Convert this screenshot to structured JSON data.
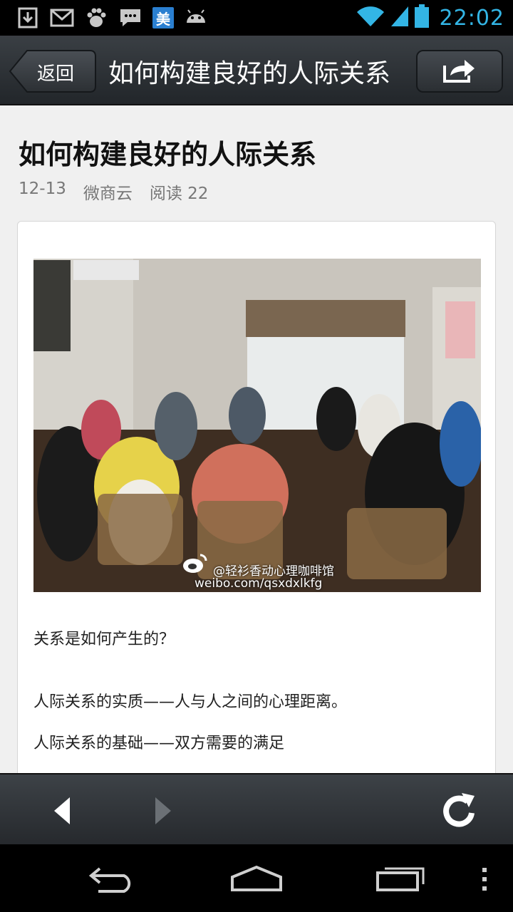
{
  "status_bar": {
    "time": "22:02",
    "left_icons": [
      "download-icon",
      "gmail-icon",
      "baidu-icon",
      "message-icon",
      "meituan-icon",
      "android-icon"
    ],
    "meituan_glyph": "美",
    "right_icons": [
      "wifi-icon",
      "signal-icon",
      "battery-icon"
    ],
    "accent_color": "#33b5e5"
  },
  "top_bar": {
    "back_label": "返回",
    "title": "如何构建良好的人际关系",
    "share_icon": "share-icon"
  },
  "article": {
    "title": "如何构建良好的人际关系",
    "date": "12-13",
    "source": "微商云",
    "read_label": "阅读 22",
    "image": {
      "watermark_account": "@轻衫香动心理咖啡馆",
      "watermark_url": "weibo.com/qsxdxlkfg"
    },
    "paragraphs": [
      "关系是如何产生的？",
      "人际关系的实质——人与人之间的心理距离。",
      "人际关系的基础——双方需要的满足"
    ]
  },
  "browser_bar": {
    "back_icon": "nav-back-icon",
    "forward_icon": "nav-forward-icon",
    "refresh_icon": "refresh-icon"
  },
  "system_nav": {
    "icons": [
      "sys-back-icon",
      "sys-home-icon",
      "sys-recent-icon",
      "sys-menu-icon"
    ]
  }
}
